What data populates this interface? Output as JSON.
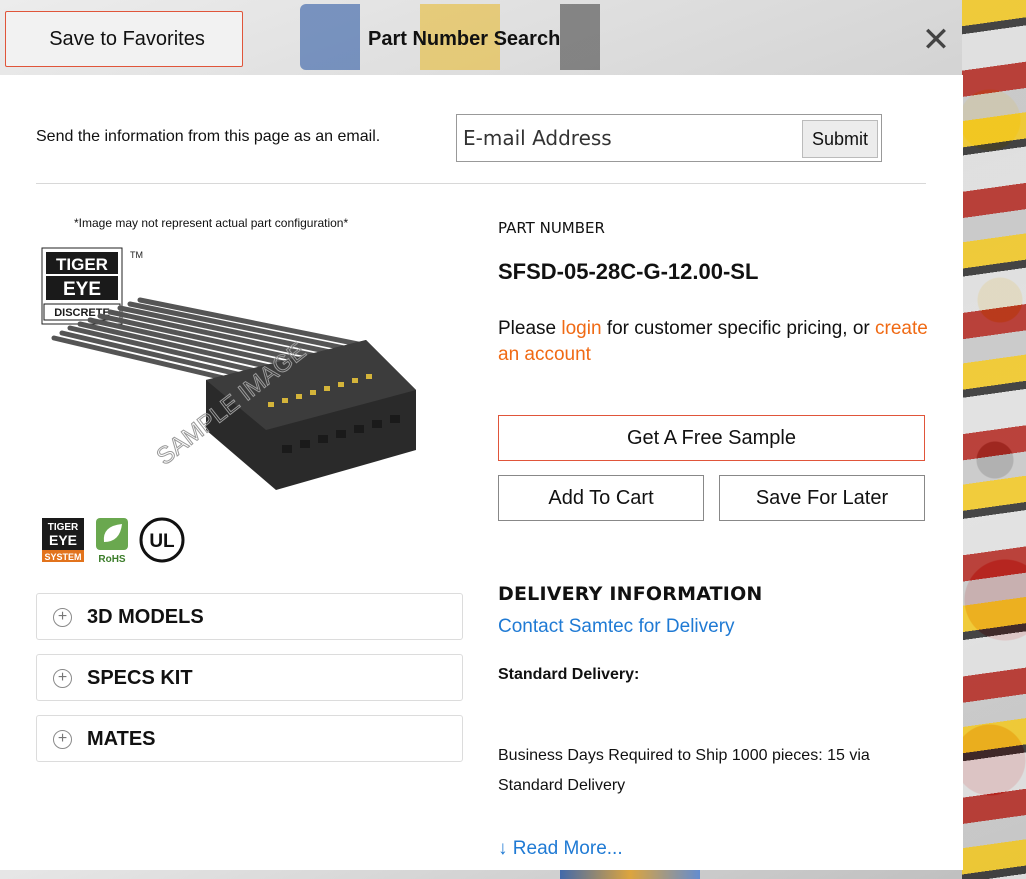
{
  "topbar": {
    "favorites_label": "Save to Favorites",
    "title": "Part Number Search",
    "close_glyph": "✕"
  },
  "email": {
    "label": "Send the information from this page as an email.",
    "placeholder": "E-mail Address",
    "submit_label": "Submit"
  },
  "image": {
    "note": "*Image may not represent actual part configuration*",
    "watermark": "SAMPLE IMAGE",
    "brand_logo": [
      "TIGER",
      "EYE",
      "DISCRETE"
    ],
    "trademark": "TM"
  },
  "badges": {
    "tiger_eye": [
      "TIGER",
      "EYE",
      "SYSTEM"
    ],
    "rohs": "RoHS",
    "ul": "UL"
  },
  "accordions": [
    {
      "label": "3D MODELS"
    },
    {
      "label": "SPECS KIT"
    },
    {
      "label": "MATES"
    }
  ],
  "part": {
    "label": "PART NUMBER",
    "value": "SFSD-05-28C-G-12.00-SL"
  },
  "pricing": {
    "prefix": "Please",
    "login_link": "login",
    "middle": "for customer specific pricing, or",
    "create_link": "create an account"
  },
  "actions": {
    "sample_label": "Get A Free Sample",
    "cart_label": "Add To Cart",
    "later_label": "Save For Later"
  },
  "delivery": {
    "heading": "DELIVERY INFORMATION",
    "contact_link": "Contact Samtec for Delivery",
    "standard_label": "Standard Delivery:",
    "ship_text": "Business Days Required to Ship 1000 pieces: 15 via Standard Delivery",
    "read_more": "↓ Read More..."
  },
  "colors": {
    "accent_orange": "#f06a14",
    "link_blue": "#1f7ad4",
    "button_border_red": "#e0553a"
  }
}
